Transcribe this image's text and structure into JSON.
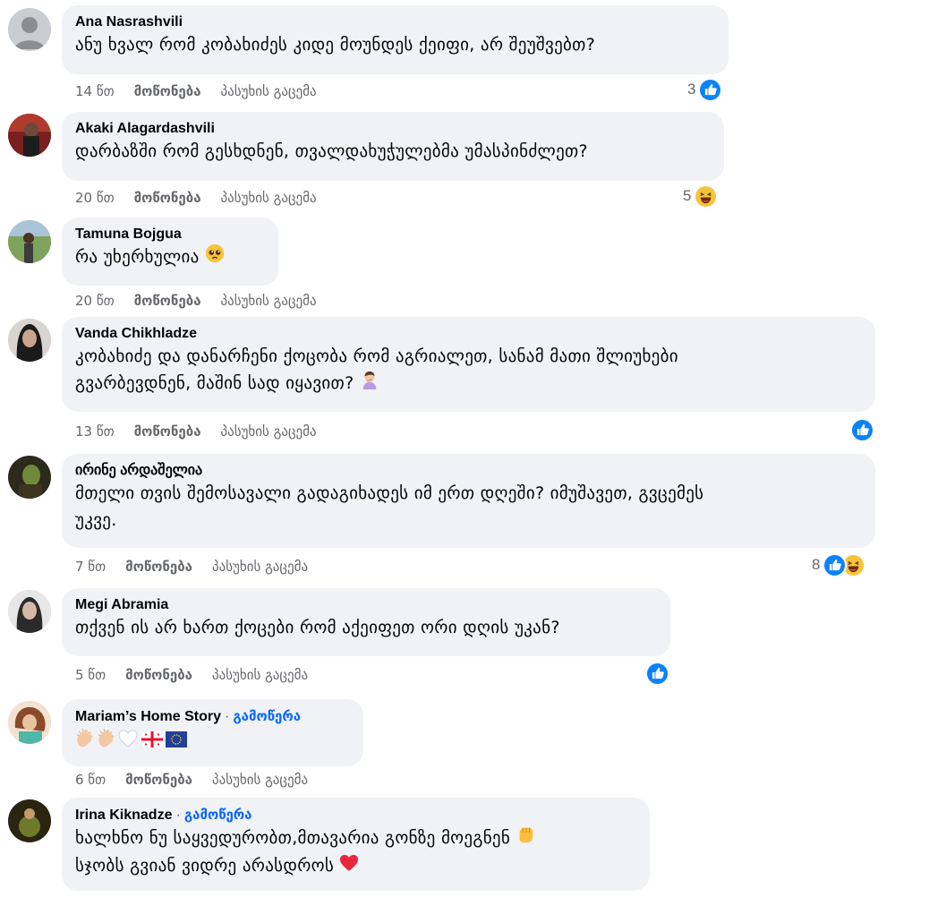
{
  "actions": {
    "like_label": "მოწონება",
    "reply_label": "პასუხის გაცემა"
  },
  "follow_label": "გამოწერა",
  "follow_separator": "·",
  "comments": [
    {
      "author": "Ana Nasrashvili",
      "lines": [
        "ანუ ხვალ რომ კობახიძეს კიდე მოუნდეს ქეიფი, არ შეუშვებთ?"
      ],
      "time": "14 წთ",
      "reaction_count": "3",
      "reactions": [
        "like-icon"
      ]
    },
    {
      "author": "Akaki Alagardashvili",
      "lines": [
        "დარბაზში რომ გესხდნენ, თვალდახუჭულებმა უმასპინძლეთ?"
      ],
      "time": "20 წთ",
      "reaction_count": "5",
      "reactions": [
        "haha-icon"
      ]
    },
    {
      "author": "Tamuna Bojgua",
      "lines": [
        "რა უხერხულია"
      ],
      "time": "20 წთ",
      "reaction_count": "",
      "reactions": []
    },
    {
      "author": "Vanda Chikhladze",
      "lines": [
        "კობახიძე და დანარჩენი ქოცობა რომ აგრიალეთ, სანამ მათი შლიუხები",
        "გვარბევდნენ, მაშინ სად იყავით?"
      ],
      "time": "13 წთ",
      "reaction_count": "",
      "reactions": [
        "like-icon"
      ]
    },
    {
      "author": "ირინე არდაშელია",
      "lines": [
        "მთელი თვის შემოსავალი გადაგიხადეს იმ ერთ დღეში? იმუშავეთ, გვცემეს",
        "უკვე."
      ],
      "time": "7 წთ",
      "reaction_count": "8",
      "reactions": [
        "like-icon",
        "haha-icon"
      ]
    },
    {
      "author": "Megi Abramia",
      "lines": [
        "თქვენ ის არ ხართ ქოცები რომ აქეიფეთ ორი დღის უკან?"
      ],
      "time": "5 წთ",
      "reaction_count": "",
      "reactions": [
        "like-icon"
      ]
    },
    {
      "author": "Mariam’s Home Story",
      "lines": [
        ""
      ],
      "time": "6 წთ",
      "reaction_count": "",
      "reactions": []
    },
    {
      "author": "Irina Kiknadze",
      "lines": [
        "ხალხნო ნუ საყვედურობთ,მთავარია გონზე მოეგნენ",
        "სჯობს გვიან ვიდრე არასდროს"
      ],
      "time": "",
      "reaction_count": "",
      "reactions": []
    }
  ],
  "colors": {
    "bubble": "#f0f2f5",
    "meta": "#65676b",
    "link": "#0866ff",
    "like_blue": "#0b82f8",
    "haha_yellow": "#f7c33a"
  }
}
